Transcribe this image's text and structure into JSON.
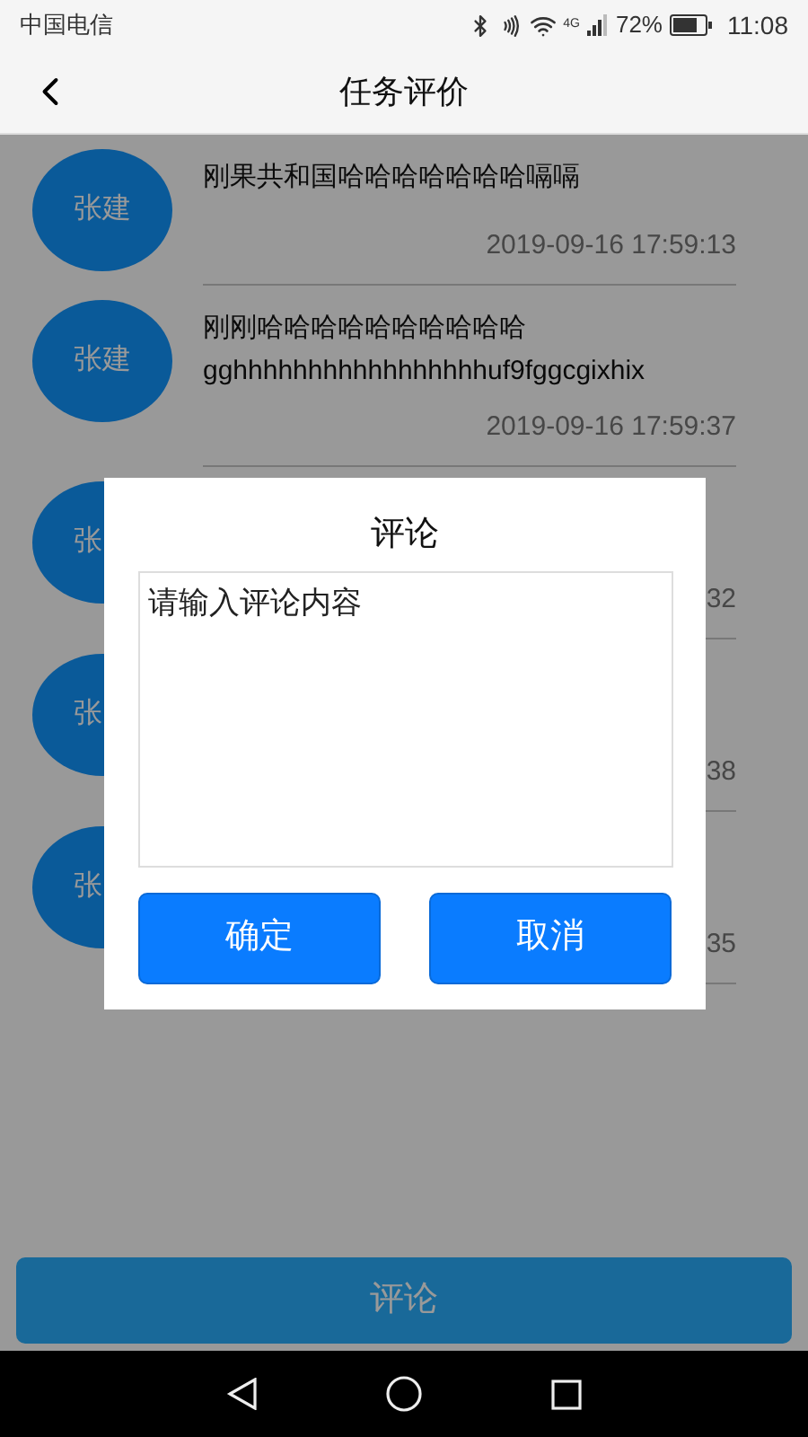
{
  "status_bar": {
    "carrier": "中国电信",
    "network": "4G",
    "battery": "72%",
    "time": "11:08"
  },
  "header": {
    "title": "任务评价"
  },
  "comments": [
    {
      "avatar": "张建",
      "lines": [
        "刚果共和国哈哈哈哈哈哈哈嗝嗝"
      ],
      "time": "2019-09-16 17:59:13"
    },
    {
      "avatar": "张建",
      "lines": [
        "刚刚哈哈哈哈哈哈哈哈哈哈",
        "gghhhhhhhhhhhhhhhhhuf9fggcgixhix"
      ],
      "time": "2019-09-16 17:59:37"
    },
    {
      "avatar": "张",
      "time": "32"
    },
    {
      "avatar": "张",
      "time": "38"
    },
    {
      "avatar": "张",
      "time": "35"
    }
  ],
  "comment_button": "评论",
  "dialog": {
    "title": "评论",
    "placeholder": "请输入评论内容",
    "buttons": [
      "确定",
      "取消"
    ]
  }
}
